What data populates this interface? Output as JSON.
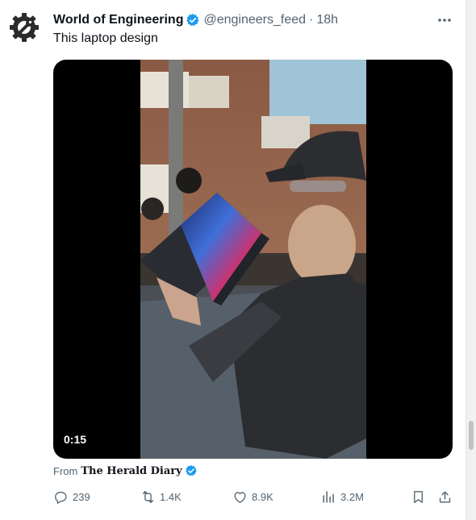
{
  "tweet": {
    "author_name": "World of Engineering",
    "handle": "@engineers_feed",
    "separator": "·",
    "time": "18h",
    "text": "This laptop design"
  },
  "media": {
    "duration": "0:15"
  },
  "source": {
    "prefix": "From",
    "publisher": "The Herald Diary"
  },
  "actions": {
    "replies": "239",
    "reposts": "1.4K",
    "likes": "8.9K",
    "views": "3.2M"
  },
  "icons": {
    "avatar": "gear-wrench-logo",
    "verified": "verified-badge-icon",
    "more": "more-icon",
    "reply": "reply-icon",
    "repost": "repost-icon",
    "like": "heart-icon",
    "views": "views-icon",
    "bookmark": "bookmark-icon",
    "share": "share-icon"
  },
  "colors": {
    "verified": "#1d9bf0",
    "text_secondary": "#536471",
    "text_primary": "#0f1419"
  }
}
